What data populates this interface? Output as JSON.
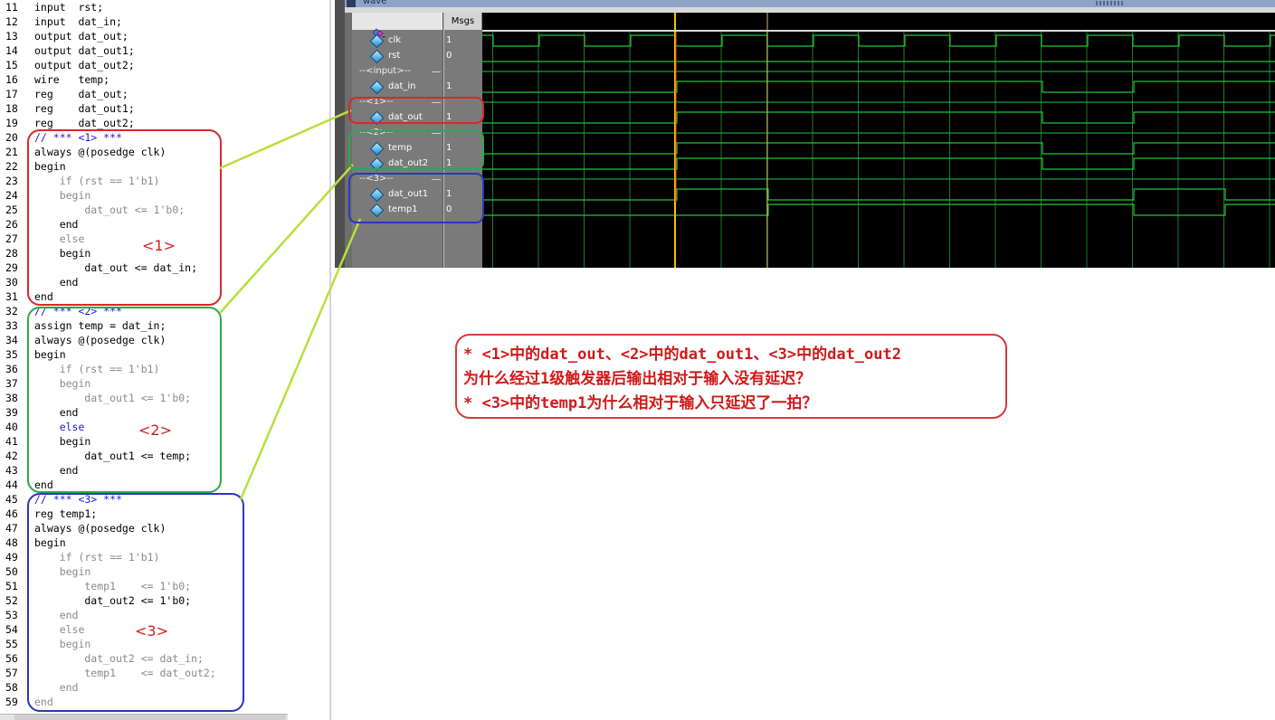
{
  "editor": {
    "lines": [
      {
        "n": "11",
        "t": "input  rst;",
        "c": ""
      },
      {
        "n": "12",
        "t": "input  dat_in;",
        "c": ""
      },
      {
        "n": "13",
        "t": "output dat_out;",
        "c": ""
      },
      {
        "n": "14",
        "t": "output dat_out1;",
        "c": ""
      },
      {
        "n": "15",
        "t": "output dat_out2;",
        "c": ""
      },
      {
        "n": "16",
        "t": "wire   temp;",
        "c": ""
      },
      {
        "n": "17",
        "t": "reg    dat_out;",
        "c": ""
      },
      {
        "n": "18",
        "t": "reg    dat_out1;",
        "c": ""
      },
      {
        "n": "19",
        "t": "reg    dat_out2;",
        "c": ""
      },
      {
        "n": "20",
        "t": "// *** <1> ***",
        "c": "k-cmt"
      },
      {
        "n": "21",
        "t": "always @(posedge clk)",
        "c": ""
      },
      {
        "n": "22",
        "t": "begin",
        "c": ""
      },
      {
        "n": "23",
        "t": "    if (rst == 1'b1)",
        "c": "if"
      },
      {
        "n": "24",
        "t": "    begin",
        "c": "k-gray"
      },
      {
        "n": "25",
        "t": "        dat_out <= 1'b0;",
        "c": "k-gray"
      },
      {
        "n": "26",
        "t": "    end",
        "c": ""
      },
      {
        "n": "27",
        "t": "    else",
        "c": "k-gray"
      },
      {
        "n": "28",
        "t": "    begin",
        "c": ""
      },
      {
        "n": "29",
        "t": "        dat_out <= dat_in;",
        "c": ""
      },
      {
        "n": "30",
        "t": "    end",
        "c": ""
      },
      {
        "n": "31",
        "t": "end",
        "c": ""
      },
      {
        "n": "32",
        "t": "// *** <2> ***",
        "c": "k-cmt"
      },
      {
        "n": "33",
        "t": "assign temp = dat_in;",
        "c": ""
      },
      {
        "n": "34",
        "t": "always @(posedge clk)",
        "c": ""
      },
      {
        "n": "35",
        "t": "begin",
        "c": ""
      },
      {
        "n": "36",
        "t": "    if (rst == 1'b1)",
        "c": "if"
      },
      {
        "n": "37",
        "t": "    begin",
        "c": "k-gray"
      },
      {
        "n": "38",
        "t": "        dat_out1 <= 1'b0;",
        "c": "k-gray"
      },
      {
        "n": "39",
        "t": "    end",
        "c": ""
      },
      {
        "n": "40",
        "t": "    else",
        "c": "k-kw"
      },
      {
        "n": "41",
        "t": "    begin",
        "c": ""
      },
      {
        "n": "42",
        "t": "        dat_out1 <= temp;",
        "c": ""
      },
      {
        "n": "43",
        "t": "    end",
        "c": ""
      },
      {
        "n": "44",
        "t": "end",
        "c": ""
      },
      {
        "n": "45",
        "t": "// *** <3> ***",
        "c": "k-cmt"
      },
      {
        "n": "46",
        "t": "reg temp1;",
        "c": ""
      },
      {
        "n": "47",
        "t": "always @(posedge clk)",
        "c": ""
      },
      {
        "n": "48",
        "t": "begin",
        "c": ""
      },
      {
        "n": "49",
        "t": "    if (rst == 1'b1)",
        "c": "if"
      },
      {
        "n": "50",
        "t": "    begin",
        "c": "k-gray"
      },
      {
        "n": "51",
        "t": "        temp1    <= 1'b0;",
        "c": "k-gray"
      },
      {
        "n": "52",
        "t": "        dat_out2 <= 1'b0;",
        "c": ""
      },
      {
        "n": "53",
        "t": "    end",
        "c": "k-gray"
      },
      {
        "n": "54",
        "t": "    else",
        "c": "k-gray"
      },
      {
        "n": "55",
        "t": "    begin",
        "c": "k-gray"
      },
      {
        "n": "56",
        "t": "        dat_out2 <= dat_in;",
        "c": "k-gray"
      },
      {
        "n": "57",
        "t": "        temp1    <= dat_out2;",
        "c": "k-gray"
      },
      {
        "n": "58",
        "t": "    end",
        "c": "k-gray"
      },
      {
        "n": "59",
        "t": "end",
        "c": "k-gray"
      }
    ],
    "box_labels": [
      "<1>",
      "<2>",
      "<3>"
    ]
  },
  "wave": {
    "title": "wave",
    "values_header": "Msgs",
    "signals": [
      {
        "name": "clk",
        "value": "1",
        "type": "signal",
        "selected": true
      },
      {
        "name": "rst",
        "value": "0",
        "type": "signal"
      },
      {
        "name": "--<input>--",
        "value": "",
        "type": "divider"
      },
      {
        "name": "dat_in",
        "value": "1",
        "type": "signal"
      },
      {
        "name": "--<1>--",
        "value": "",
        "type": "divider"
      },
      {
        "name": "dat_out",
        "value": "1",
        "type": "signal"
      },
      {
        "name": "--<2>--",
        "value": "",
        "type": "divider"
      },
      {
        "name": "temp",
        "value": "1",
        "type": "signal"
      },
      {
        "name": "dat_out2",
        "value": "1",
        "type": "signal"
      },
      {
        "name": "--<3>--",
        "value": "",
        "type": "divider"
      },
      {
        "name": "dat_out1",
        "value": "1",
        "type": "signal"
      },
      {
        "name": "temp1",
        "value": "0",
        "type": "signal"
      }
    ],
    "colors": {
      "trace": "#22c33a",
      "cursor": "#f2c200",
      "canvas": "#000000"
    }
  },
  "note": {
    "line1": "* <1>中的dat_out、<2>中的dat_out1、<3>中的dat_out2",
    "line2": "为什么经过1级触发器后输出相对于输入没有延迟？",
    "line3": "* <3>中的temp1为什么相对于输入只延迟了一拍？"
  },
  "colors": {
    "box1": "#d42a2a",
    "box2": "#2fa84a",
    "box3": "#2a38b8",
    "connector": "#b8e03c",
    "note_border": "#d63a3a"
  }
}
